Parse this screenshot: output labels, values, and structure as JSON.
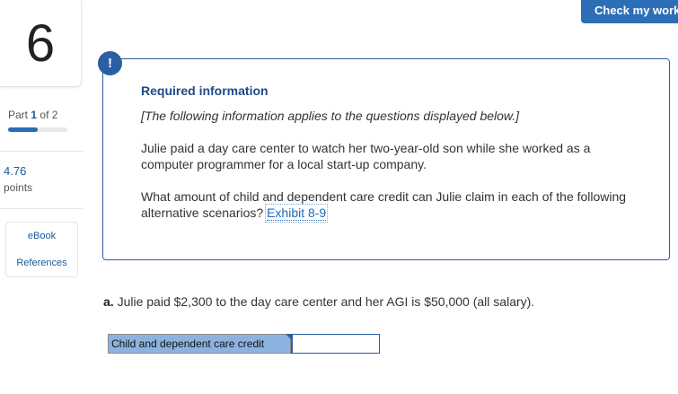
{
  "question_number": "6",
  "part": {
    "prefix": "Part",
    "number": "1",
    "suffix": "of 2",
    "progress": 0.5
  },
  "points": {
    "value": "4.76",
    "label": "points"
  },
  "side_links": [
    "eBook",
    "References"
  ],
  "header": {
    "check_button": "Check my work"
  },
  "alert_icon": "!",
  "info": {
    "title": "Required information",
    "italic_note": "[The following information applies to the questions displayed below.]",
    "paragraph1": "Julie paid a day care center to watch her two-year-old son while she worked as a computer programmer for a local start-up company.",
    "paragraph2": "What amount of child and dependent care credit can Julie claim in each of the following alternative scenarios?",
    "exhibit_link": "Exhibit 8-9"
  },
  "question_a": {
    "label": "a.",
    "text": "Julie paid $2,300 to the day care center and her AGI is $50,000 (all salary)."
  },
  "answer": {
    "row_label": "Child and dependent care credit",
    "value": ""
  },
  "colors": {
    "accent": "#2d6fb6",
    "label_bg": "#8cb2e0",
    "link": "#1a6bbf"
  }
}
